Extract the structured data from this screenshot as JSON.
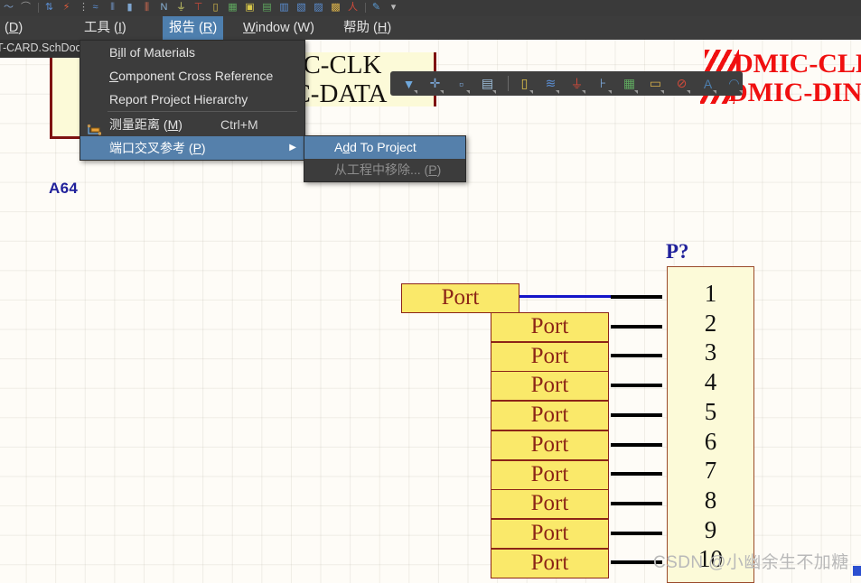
{
  "app": {
    "tab_label": "T-CARD.SchDoc"
  },
  "menubar": {
    "items": [
      {
        "label": "(D)",
        "underline": "D",
        "active": false
      },
      {
        "label": "工具 (I)",
        "underline": "I",
        "active": false
      },
      {
        "label": "报告 (R)",
        "underline": "R",
        "active": true
      },
      {
        "label": "Window (W)",
        "underline": "W",
        "active": false
      },
      {
        "label": "帮助 (H)",
        "underline": "H",
        "active": false
      }
    ]
  },
  "dropdown": {
    "name": "报告 (R)",
    "items": [
      {
        "label": "Bill of Materials",
        "accel": "",
        "icon": "",
        "selected": false,
        "arrow": false
      },
      {
        "label": "Component Cross Reference",
        "accel": "",
        "icon": "",
        "selected": false,
        "arrow": false
      },
      {
        "label": "Report Project Hierarchy",
        "accel": "",
        "icon": "",
        "selected": false,
        "arrow": false
      },
      {
        "label": "测量距离 (M)",
        "accel": "Ctrl+M",
        "icon": "ruler-icon",
        "selected": false,
        "arrow": false
      },
      {
        "label": "端口交叉参考 (P)",
        "accel": "",
        "icon": "",
        "selected": true,
        "arrow": true
      }
    ]
  },
  "submenu": {
    "items": [
      {
        "label": "Add To Project",
        "selected": true,
        "disabled": false
      },
      {
        "label": "从工程中移除... (P)",
        "selected": false,
        "disabled": true
      }
    ]
  },
  "toolbar_top": {
    "icons": [
      "wave-icon",
      "curve-icon",
      "separator",
      "swap-arrows-icon",
      "lightning-icon",
      "dots-icon",
      "signal-icon",
      "bus-icon",
      "port-icon",
      "net-icon",
      "neu-icon",
      "ground-icon",
      "power-icon",
      "component-icon",
      "sheet-symbol-icon",
      "place-part-icon",
      "green-image-icon",
      "device-icon",
      "blue-block-icon",
      "blue-block2-icon",
      "yellow-note-icon",
      "person-icon",
      "separator2",
      "pen-icon",
      "chevron-down-icon"
    ]
  },
  "toolbar_float": {
    "icons": [
      "filter-icon",
      "crosshair-icon",
      "select-area-icon",
      "align-icon",
      "separator",
      "component-icon",
      "wire-icon",
      "ground-icon",
      "netlabel-icon",
      "sheet-symbol-icon",
      "port-icon",
      "no-erc-icon",
      "text-icon",
      "arc-icon"
    ]
  },
  "schematic": {
    "left_component_label": "A64",
    "net_labels_black": [
      "MIC-CLK",
      "MIC-DATA"
    ],
    "net_labels_red": [
      "DMIC-CLK",
      "DMIC-DIN"
    ],
    "connector": {
      "designator": "P?",
      "pins": [
        "1",
        "2",
        "3",
        "4",
        "5",
        "6",
        "7",
        "8",
        "9",
        "10"
      ]
    },
    "ports": [
      {
        "label": "Port",
        "style": "wide"
      },
      {
        "label": "Port",
        "style": "stack"
      },
      {
        "label": "Port",
        "style": "stack"
      },
      {
        "label": "Port",
        "style": "stack"
      },
      {
        "label": "Port",
        "style": "stack"
      },
      {
        "label": "Port",
        "style": "stack"
      },
      {
        "label": "Port",
        "style": "stack"
      },
      {
        "label": "Port",
        "style": "stack"
      },
      {
        "label": "Port",
        "style": "stack"
      },
      {
        "label": "Port",
        "style": "stack"
      }
    ]
  },
  "watermark": {
    "text": "CSDN @小幽余生不加糖"
  },
  "colors": {
    "canvas_bg": "#FEFCF7",
    "port_fill": "#FAE96A",
    "port_border": "#8C2517",
    "component_fill": "#FCFAD8",
    "component_border": "#9A4A2A",
    "designator_blue": "#20219B",
    "wire_blue": "#1414C8",
    "error_red": "#F01010",
    "menu_bg": "#3C3C3C",
    "menu_highlight": "#5580AB"
  }
}
